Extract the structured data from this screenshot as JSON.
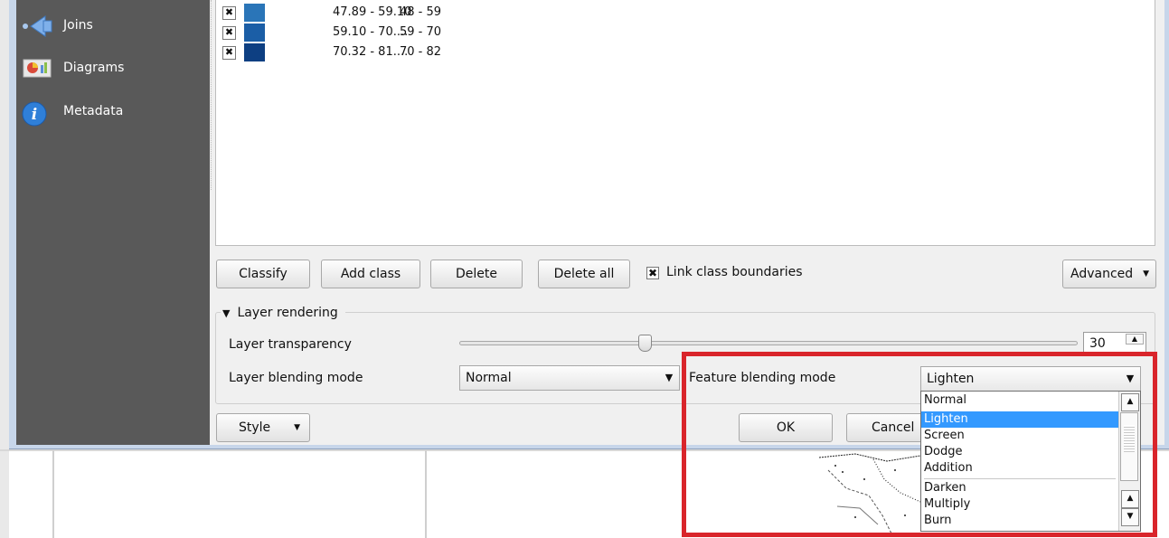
{
  "sidebar": {
    "items": [
      {
        "label": "Joins",
        "icon": "joins-arrow-icon"
      },
      {
        "label": "Diagrams",
        "icon": "diagrams-icon"
      },
      {
        "label": "Metadata",
        "icon": "info-icon"
      }
    ]
  },
  "classes": [
    {
      "checked": true,
      "color": "#2a75b8",
      "value": "47.89 - 59.10",
      "legend": "48 - 59"
    },
    {
      "checked": true,
      "color": "#1b5ea6",
      "value": "59.10 - 70....",
      "legend": "59 - 70"
    },
    {
      "checked": true,
      "color": "#0d3f82",
      "value": "70.32 - 81....",
      "legend": "70 - 82"
    }
  ],
  "toolbar": {
    "classify": "Classify",
    "add_class": "Add class",
    "delete": "Delete",
    "delete_all": "Delete all",
    "link_class_boundaries": "Link class boundaries",
    "advanced": "Advanced"
  },
  "layer_rendering": {
    "title": "Layer rendering",
    "transparency_label": "Layer transparency",
    "transparency_value": "30",
    "transparency_level": 30,
    "blending_label": "Layer blending mode",
    "blending_value": "Normal",
    "feature_blending_label": "Feature blending mode",
    "feature_blending_value": "Lighten"
  },
  "dropdown": {
    "options": [
      "Normal",
      "Lighten",
      "Screen",
      "Dodge",
      "Addition",
      "Darken",
      "Multiply",
      "Burn"
    ],
    "selected": "Lighten"
  },
  "footer": {
    "style": "Style",
    "ok": "OK",
    "cancel": "Cancel"
  },
  "colors": {
    "sidebar_bg": "#595959",
    "selection": "#3399ff",
    "highlight_box": "#d9252b"
  }
}
